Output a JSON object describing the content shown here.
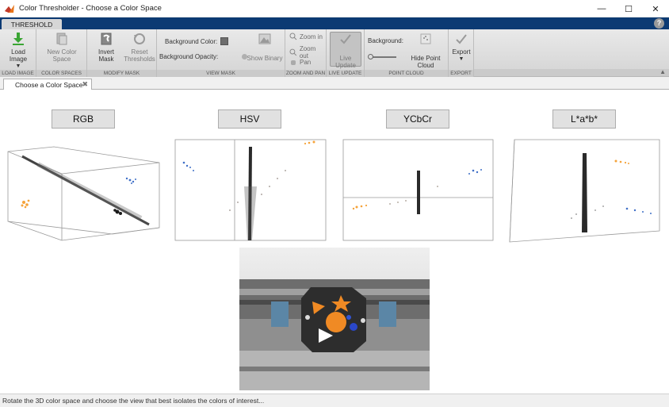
{
  "window": {
    "title": "Color Thresholder - Choose a Color Space",
    "minimize": "—",
    "maximize": "☐",
    "close": "✕"
  },
  "ribbon_tabs": [
    {
      "label": "THRESHOLD"
    }
  ],
  "help_label": "?",
  "ribbon": {
    "load_image": {
      "label": "Load Image",
      "section": "LOAD IMAGE"
    },
    "color_spaces": {
      "new_color_space": "New Color Space",
      "section": "COLOR SPACES"
    },
    "modify_mask": {
      "invert_mask": "Invert Mask",
      "reset_thresholds_1": "Reset",
      "reset_thresholds_2": "Thresholds",
      "section": "MODIFY MASK"
    },
    "view_mask": {
      "background_color": "Background Color:",
      "background_opacity": "Background Opacity:",
      "show_binary": "Show Binary",
      "section": "VIEW MASK"
    },
    "zoom_pan": {
      "zoom_in": "Zoom in",
      "zoom_out": "Zoom out",
      "pan": "Pan",
      "section": "ZOOM AND PAN"
    },
    "live_update": {
      "label": "Live Update",
      "section": "LIVE UPDATE"
    },
    "point_cloud": {
      "background": "Background:",
      "hide_point_cloud": "Hide Point Cloud",
      "section": "POINT CLOUD"
    },
    "export": {
      "label": "Export",
      "section": "EXPORT"
    }
  },
  "document_tab": {
    "label": "Choose a Color Space",
    "close": "✖"
  },
  "color_spaces": [
    {
      "label": "RGB"
    },
    {
      "label": "HSV"
    },
    {
      "label": "YCbCr"
    },
    {
      "label": "L*a*b*"
    }
  ],
  "status": "Rotate the 3D color space and choose the view that best isolates the colors of interest...",
  "colors": {
    "ribbon_tab_bg": "#0c3a73",
    "point_orange": "#f5a33a",
    "point_blue": "#3f6fc7",
    "point_dark": "#1a1a1a"
  }
}
